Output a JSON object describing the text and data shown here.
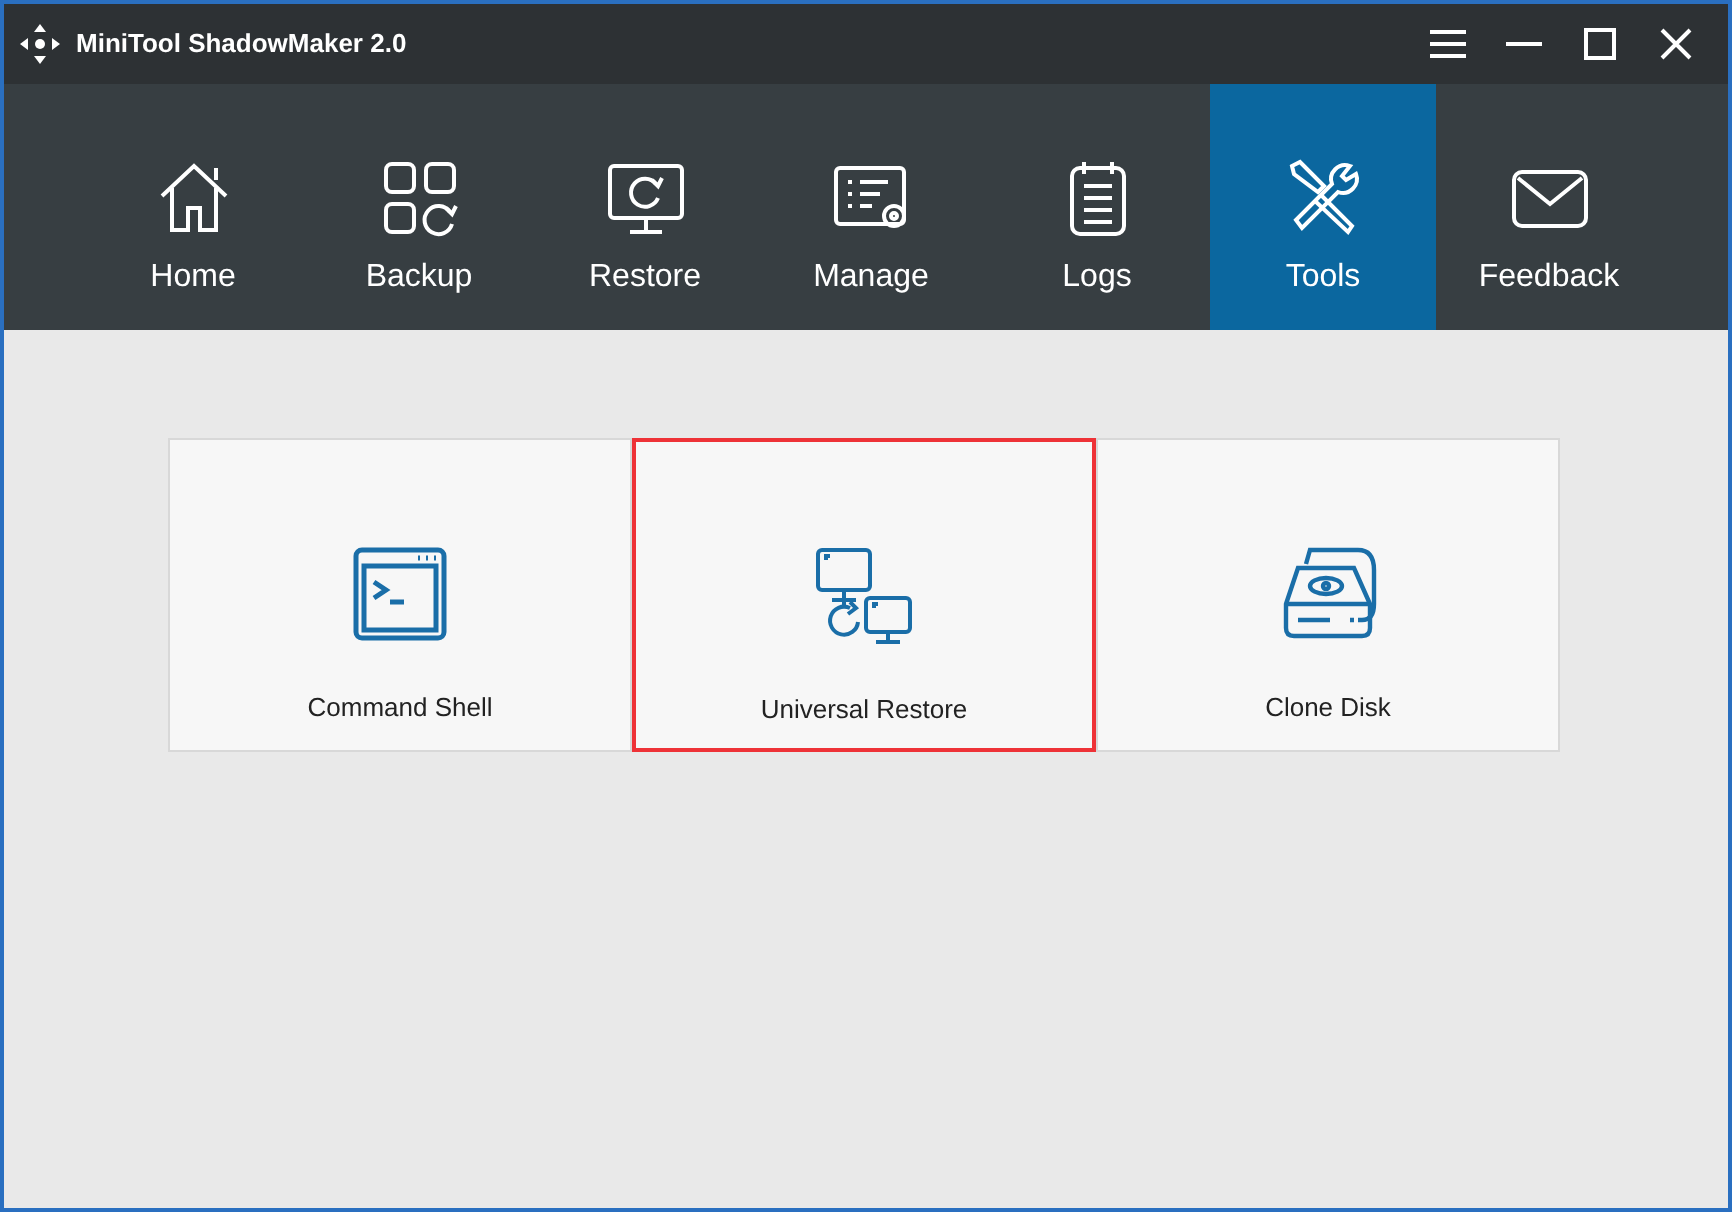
{
  "window": {
    "title": "MiniTool ShadowMaker 2.0"
  },
  "tabs": [
    {
      "label": "Home",
      "selected": false
    },
    {
      "label": "Backup",
      "selected": false
    },
    {
      "label": "Restore",
      "selected": false
    },
    {
      "label": "Manage",
      "selected": false
    },
    {
      "label": "Logs",
      "selected": false
    },
    {
      "label": "Tools",
      "selected": true
    },
    {
      "label": "Feedback",
      "selected": false
    }
  ],
  "tools": [
    {
      "label": "Command Shell",
      "highlighted": false
    },
    {
      "label": "Universal Restore",
      "highlighted": true
    },
    {
      "label": "Clone Disk",
      "highlighted": false
    }
  ]
}
